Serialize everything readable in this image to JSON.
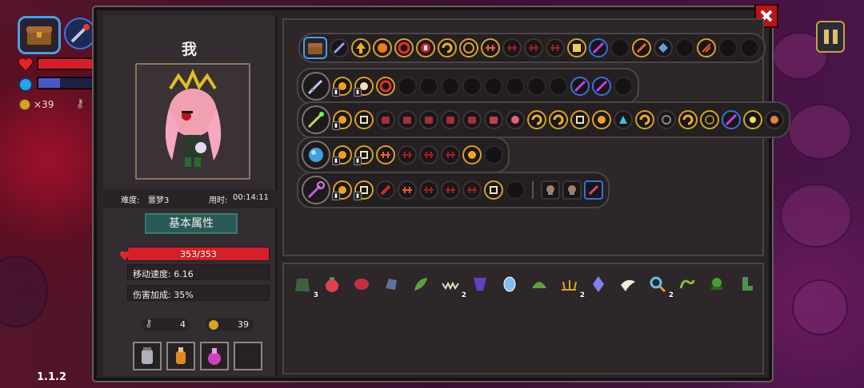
{
  "hud": {
    "coins": "×39",
    "version": "1.1.2"
  },
  "player": {
    "name": "我",
    "difficulty_label": "难度:",
    "difficulty_value": "噩梦3",
    "time_label": "用时:",
    "time_value": "00:14:11",
    "tab_label": "基本属性",
    "hp": "353/353",
    "hp_fraction": 1.0,
    "move_speed": "移动速度: 6.16",
    "damage_bonus": "伤害加成: 35%",
    "keys": "4",
    "coins": "39"
  },
  "items": {
    "c0": "3",
    "c6": "2",
    "c12": "2",
    "c16": "2"
  },
  "colors": {
    "accent": "#d7a227",
    "hp_red": "#d4202a",
    "mana_blue": "#3b6fd8",
    "close_red": "#b8141c"
  }
}
